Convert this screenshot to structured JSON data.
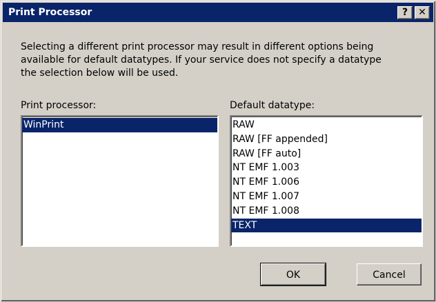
{
  "window": {
    "title": "Print Processor",
    "help_label": "?",
    "close_label": "✕"
  },
  "description": {
    "lines": [
      "Selecting a different print processor may result in different options being",
      "available for default datatypes. If your service does not specify a datatype",
      "the selection below will be used."
    ]
  },
  "print_processor": {
    "label": "Print processor:",
    "items": [
      "WinPrint"
    ],
    "selected": "WinPrint"
  },
  "default_datatype": {
    "label": "Default datatype:",
    "items": [
      "RAW",
      "RAW [FF appended]",
      "RAW [FF auto]",
      "NT EMF 1.003",
      "NT EMF 1.006",
      "NT EMF 1.007",
      "NT EMF 1.008",
      "TEXT"
    ],
    "selected": "TEXT"
  },
  "buttons": {
    "ok": "OK",
    "cancel": "Cancel"
  },
  "colors": {
    "titlebar": "#0a246a",
    "selection": "#0a246a",
    "face": "#d4d0c8"
  }
}
